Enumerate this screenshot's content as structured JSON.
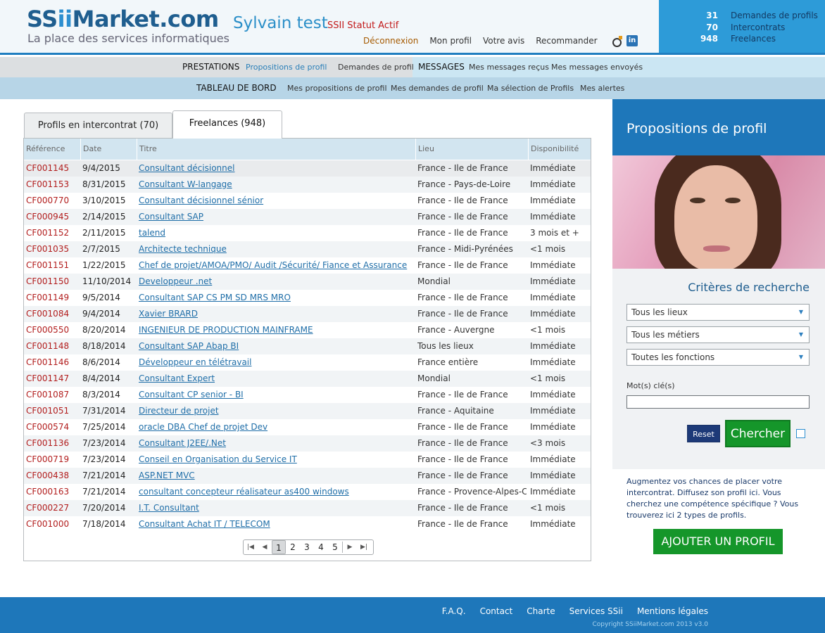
{
  "header": {
    "logo_main_a": "SS",
    "logo_main_ii": "ii",
    "logo_main_b": "Market.com",
    "logo_sub": "La place des services informatiques",
    "user_name": "Sylvain test",
    "user_status": "SSII Statut Actif",
    "nav": {
      "logout": "Déconnexion",
      "profile": "Mon profil",
      "feedback": "Votre avis",
      "recommend": "Recommander"
    },
    "linkedin": "in"
  },
  "stats": [
    {
      "num": "31",
      "label": "Demandes de profils"
    },
    {
      "num": "70",
      "label": "Intercontrats"
    },
    {
      "num": "948",
      "label": "Freelances"
    }
  ],
  "nav1": {
    "prestations": "PRESTATIONS",
    "propositions": "Propositions de profil",
    "demandes": "Demandes de profil",
    "messages": "MESSAGES",
    "recus": "Mes messages reçus",
    "envoyes": "Mes messages envoyés"
  },
  "nav2": {
    "tableau": "TABLEAU DE BORD",
    "mes_props": "Mes propositions de profil",
    "mes_dem": "Mes demandes de profil",
    "selection": "Ma sélection de Profils",
    "alertes": "Mes alertes"
  },
  "tabs": {
    "intercontrat": "Profils en intercontrat (70)",
    "freelances": "Freelances (948)"
  },
  "grid": {
    "headers": [
      "Référence",
      "Date",
      "Titre",
      "Lieu",
      "Disponibilité"
    ],
    "rows": [
      [
        "CF001145",
        "9/4/2015",
        "Consultant décisionnel",
        "France - Ile de France",
        "Immédiate"
      ],
      [
        "CF001153",
        "8/31/2015",
        "Consultant W-langage",
        "France - Pays-de-Loire",
        "Immédiate"
      ],
      [
        "CF000770",
        "3/10/2015",
        "Consultant décisionnel sénior",
        "France - Ile de France",
        "Immédiate"
      ],
      [
        "CF000945",
        "2/14/2015",
        "Consultant SAP",
        "France - Ile de France",
        "Immédiate"
      ],
      [
        "CF001152",
        "2/11/2015",
        "talend",
        "France - Ile de France",
        "3 mois et +"
      ],
      [
        "CF001035",
        "2/7/2015",
        "Architecte technique",
        "France - Midi-Pyrénées",
        "<1 mois"
      ],
      [
        "CF001151",
        "1/22/2015",
        "Chef de projet/AMOA/PMO/ Audit  /Sécurité/ Fiance et Assurance",
        "France - Ile de France",
        "Immédiate"
      ],
      [
        "CF001150",
        "11/10/2014",
        "Developpeur .net",
        "Mondial",
        "Immédiate"
      ],
      [
        "CF001149",
        "9/5/2014",
        "Consultant SAP CS PM SD MRS MRO",
        "France - Ile de France",
        "Immédiate"
      ],
      [
        "CF001084",
        "9/4/2014",
        "Xavier BRARD",
        "France - Ile de France",
        "Immédiate"
      ],
      [
        "CF000550",
        "8/20/2014",
        "INGENIEUR DE PRODUCTION MAINFRAME",
        "France - Auvergne",
        "<1 mois"
      ],
      [
        "CF001148",
        "8/18/2014",
        "Consultant SAP Abap BI",
        "Tous les lieux",
        "Immédiate"
      ],
      [
        "CF001146",
        "8/6/2014",
        "Développeur en télétravail",
        "France entière",
        "Immédiate"
      ],
      [
        "CF001147",
        "8/4/2014",
        "Consultant Expert",
        "Mondial",
        "<1 mois"
      ],
      [
        "CF001087",
        "8/3/2014",
        "Consultant CP senior - BI",
        "France - Ile de France",
        "Immédiate"
      ],
      [
        "CF001051",
        "7/31/2014",
        "Directeur de projet",
        "France - Aquitaine",
        "Immédiate"
      ],
      [
        "CF000574",
        "7/25/2014",
        "oracle DBA Chef de projet Dev",
        "France - Ile de France",
        "Immédiate"
      ],
      [
        "CF001136",
        "7/23/2014",
        "Consultant J2EE/.Net",
        "France - Ile de France",
        "<3 mois"
      ],
      [
        "CF000719",
        "7/23/2014",
        "Conseil en Organisation du Service IT",
        "France - Ile de France",
        "Immédiate"
      ],
      [
        "CF000438",
        "7/21/2014",
        "ASP.NET MVC",
        "France - Ile de France",
        "Immédiate"
      ],
      [
        "CF000163",
        "7/21/2014",
        "consultant concepteur réalisateur as400 windows",
        "France - Provence-Alpes-C",
        "Immédiate"
      ],
      [
        "CF000227",
        "7/20/2014",
        "I.T. Consultant",
        "France - Ile de France",
        "<1 mois"
      ],
      [
        "CF001000",
        "7/18/2014",
        "Consultant Achat IT / TELECOM",
        "France - Ile de France",
        "Immédiate"
      ]
    ]
  },
  "pager": {
    "pages": [
      "1",
      "2",
      "3",
      "4",
      "5"
    ],
    "current": "1"
  },
  "right_panel": {
    "title": "Propositions de profil",
    "criteria_title": "Critères de recherche",
    "select_lieux": "Tous les lieux",
    "select_metiers": "Tous les métiers",
    "select_fonctions": "Toutes les fonctions",
    "keywords_label": "Mot(s) clé(s)",
    "keywords_value": "",
    "reset": "Reset",
    "search": "Chercher",
    "promo_text": "Augmentez vos chances de placer votre intercontrat. Diffusez son profil ici. Vous cherchez une compétence spécifique ? Vous trouverez ici 2 types de profils.",
    "add_profile": "AJOUTER UN PROFIL"
  },
  "footer": {
    "faq": "F.A.Q.",
    "contact": "Contact",
    "charte": "Charte",
    "services": "Services SSii",
    "mentions": "Mentions légales",
    "copyright": "Copyright SSiiMarket.com 2013 v3.0"
  }
}
